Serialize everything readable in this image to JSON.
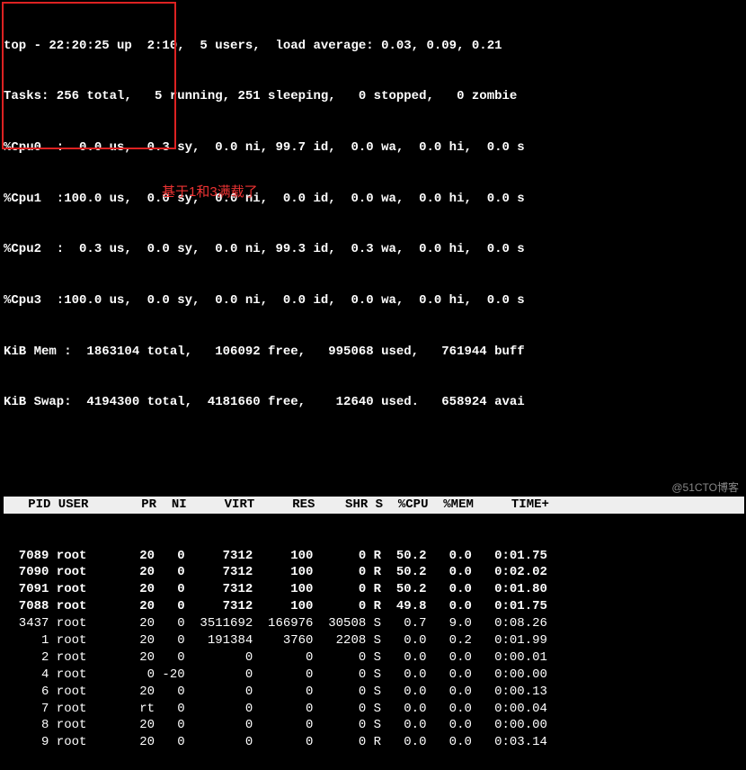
{
  "summary": {
    "uptime_line": "top - 22:20:25 up  2:10,  5 users,  load average: 0.03, 0.09, 0.21",
    "tasks_line": "Tasks: 256 total,   5 running, 251 sleeping,   0 stopped,   0 zombie",
    "cpu0": "%Cpu0  :  0.0 us,  0.3 sy,  0.0 ni, 99.7 id,  0.0 wa,  0.0 hi,  0.0 s",
    "cpu1": "%Cpu1  :100.0 us,  0.0 sy,  0.0 ni,  0.0 id,  0.0 wa,  0.0 hi,  0.0 s",
    "cpu2": "%Cpu2  :  0.3 us,  0.0 sy,  0.0 ni, 99.3 id,  0.3 wa,  0.0 hi,  0.0 s",
    "cpu3": "%Cpu3  :100.0 us,  0.0 sy,  0.0 ni,  0.0 id,  0.0 wa,  0.0 hi,  0.0 s",
    "mem_line": "KiB Mem :  1863104 total,   106092 free,   995068 used,   761944 buff",
    "swap_line": "KiB Swap:  4194300 total,  4181660 free,    12640 used.   658924 avai"
  },
  "annotation": {
    "red_text": "基于1和3满载了"
  },
  "table": {
    "headers": [
      "PID",
      "USER",
      "PR",
      "NI",
      "VIRT",
      "RES",
      "SHR",
      "S",
      "%CPU",
      "%MEM",
      "TIME+"
    ],
    "rows": [
      {
        "pid": "7089",
        "user": "root",
        "pr": "20",
        "ni": "0",
        "virt": "7312",
        "res": "100",
        "shr": "0",
        "s": "R",
        "cpu": "50.2",
        "mem": "0.0",
        "time": "0:01.75",
        "bold": true
      },
      {
        "pid": "7090",
        "user": "root",
        "pr": "20",
        "ni": "0",
        "virt": "7312",
        "res": "100",
        "shr": "0",
        "s": "R",
        "cpu": "50.2",
        "mem": "0.0",
        "time": "0:02.02",
        "bold": true
      },
      {
        "pid": "7091",
        "user": "root",
        "pr": "20",
        "ni": "0",
        "virt": "7312",
        "res": "100",
        "shr": "0",
        "s": "R",
        "cpu": "50.2",
        "mem": "0.0",
        "time": "0:01.80",
        "bold": true
      },
      {
        "pid": "7088",
        "user": "root",
        "pr": "20",
        "ni": "0",
        "virt": "7312",
        "res": "100",
        "shr": "0",
        "s": "R",
        "cpu": "49.8",
        "mem": "0.0",
        "time": "0:01.75",
        "bold": true
      },
      {
        "pid": "3437",
        "user": "root",
        "pr": "20",
        "ni": "0",
        "virt": "3511692",
        "res": "166976",
        "shr": "30508",
        "s": "S",
        "cpu": "0.7",
        "mem": "9.0",
        "time": "0:08.26",
        "bold": false
      },
      {
        "pid": "1",
        "user": "root",
        "pr": "20",
        "ni": "0",
        "virt": "191384",
        "res": "3760",
        "shr": "2208",
        "s": "S",
        "cpu": "0.0",
        "mem": "0.2",
        "time": "0:01.99",
        "bold": false
      },
      {
        "pid": "2",
        "user": "root",
        "pr": "20",
        "ni": "0",
        "virt": "0",
        "res": "0",
        "shr": "0",
        "s": "S",
        "cpu": "0.0",
        "mem": "0.0",
        "time": "0:00.01",
        "bold": false
      },
      {
        "pid": "4",
        "user": "root",
        "pr": "0",
        "ni": "-20",
        "virt": "0",
        "res": "0",
        "shr": "0",
        "s": "S",
        "cpu": "0.0",
        "mem": "0.0",
        "time": "0:00.00",
        "bold": false
      },
      {
        "pid": "6",
        "user": "root",
        "pr": "20",
        "ni": "0",
        "virt": "0",
        "res": "0",
        "shr": "0",
        "s": "S",
        "cpu": "0.0",
        "mem": "0.0",
        "time": "0:00.13",
        "bold": false
      },
      {
        "pid": "7",
        "user": "root",
        "pr": "rt",
        "ni": "0",
        "virt": "0",
        "res": "0",
        "shr": "0",
        "s": "S",
        "cpu": "0.0",
        "mem": "0.0",
        "time": "0:00.04",
        "bold": false
      },
      {
        "pid": "8",
        "user": "root",
        "pr": "20",
        "ni": "0",
        "virt": "0",
        "res": "0",
        "shr": "0",
        "s": "S",
        "cpu": "0.0",
        "mem": "0.0",
        "time": "0:00.00",
        "bold": false
      },
      {
        "pid": "9",
        "user": "root",
        "pr": "20",
        "ni": "0",
        "virt": "0",
        "res": "0",
        "shr": "0",
        "s": "R",
        "cpu": "0.0",
        "mem": "0.0",
        "time": "0:03.14",
        "bold": false
      }
    ]
  },
  "watermark": "@51CTO博客"
}
